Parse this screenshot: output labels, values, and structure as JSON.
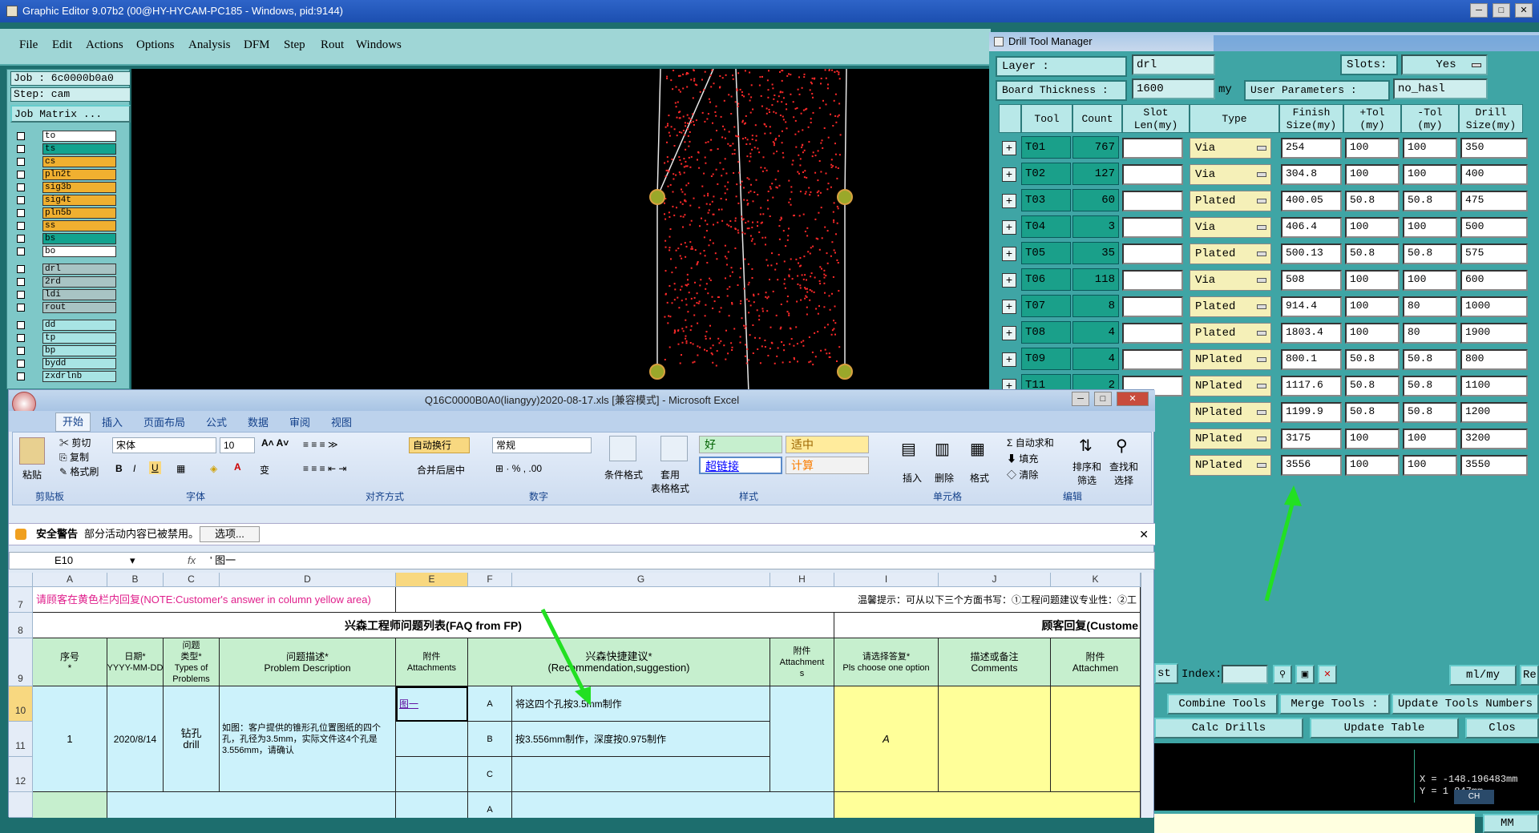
{
  "graphic_editor": {
    "title": "Graphic Editor 9.07b2 (00@HY-HYCAM-PC185 - Windows, pid:9144)",
    "menu": [
      "File",
      "Edit",
      "Actions",
      "Options",
      "Analysis",
      "DFM",
      "Step",
      "Rout",
      "Windows"
    ],
    "job": "Job : 6c0000b0a0",
    "step": "Step: cam",
    "job_matrix": "Job Matrix ...",
    "layers": [
      {
        "name": "to",
        "color": "#ffffff"
      },
      {
        "name": "ts",
        "color": "#13a38f"
      },
      {
        "name": "cs",
        "color": "#f0b030"
      },
      {
        "name": "pln2t",
        "color": "#f0b030"
      },
      {
        "name": "sig3b",
        "color": "#f0b030"
      },
      {
        "name": "sig4t",
        "color": "#f0b030"
      },
      {
        "name": "pln5b",
        "color": "#f0b030"
      },
      {
        "name": "ss",
        "color": "#f0b030"
      },
      {
        "name": "bs",
        "color": "#13a38f"
      },
      {
        "name": "bo",
        "color": "#ffffff"
      },
      {
        "name": "drl",
        "color": "#a8c4c4"
      },
      {
        "name": "2rd",
        "color": "#a8c4c4"
      },
      {
        "name": "ldi",
        "color": "#a8c4c4"
      },
      {
        "name": "rout",
        "color": "#a8c4c4"
      },
      {
        "name": "dd",
        "color": "#a8e4e4"
      },
      {
        "name": "tp",
        "color": "#a8e4e4"
      },
      {
        "name": "bp",
        "color": "#a8e4e4"
      },
      {
        "name": "bydd",
        "color": "#a8e4e4"
      },
      {
        "name": "zxdrlnb",
        "color": "#a8e4e4"
      }
    ]
  },
  "drill_tool_manager": {
    "title": "Drill Tool Manager",
    "layer_label": "Layer :",
    "layer_value": "drl",
    "slots_label": "Slots:",
    "slots_value": "Yes",
    "board_thickness_label": "Board Thickness :",
    "board_thickness_value": "1600",
    "board_thickness_unit": "my",
    "user_params_label": "User Parameters :",
    "user_params_value": "no_hasl",
    "headers": [
      "Tool",
      "Count",
      "Slot Len(my)",
      "Type",
      "Finish Size(my)",
      "+Tol (my)",
      "-Tol (my)",
      "Drill Size(my)"
    ],
    "rows": [
      {
        "tool": "T01",
        "count": "767",
        "type": "Via",
        "finish": "254",
        "ptol": "100",
        "ntol": "100",
        "drill": "350"
      },
      {
        "tool": "T02",
        "count": "127",
        "type": "Via",
        "finish": "304.8",
        "ptol": "100",
        "ntol": "100",
        "drill": "400"
      },
      {
        "tool": "T03",
        "count": "60",
        "type": "Plated",
        "finish": "400.05",
        "ptol": "50.8",
        "ntol": "50.8",
        "drill": "475"
      },
      {
        "tool": "T04",
        "count": "3",
        "type": "Via",
        "finish": "406.4",
        "ptol": "100",
        "ntol": "100",
        "drill": "500"
      },
      {
        "tool": "T05",
        "count": "35",
        "type": "Plated",
        "finish": "500.13",
        "ptol": "50.8",
        "ntol": "50.8",
        "drill": "575"
      },
      {
        "tool": "T06",
        "count": "118",
        "type": "Via",
        "finish": "508",
        "ptol": "100",
        "ntol": "100",
        "drill": "600"
      },
      {
        "tool": "T07",
        "count": "8",
        "type": "Plated",
        "finish": "914.4",
        "ptol": "100",
        "ntol": "80",
        "drill": "1000"
      },
      {
        "tool": "T08",
        "count": "4",
        "type": "Plated",
        "finish": "1803.4",
        "ptol": "100",
        "ntol": "80",
        "drill": "1900"
      },
      {
        "tool": "T09",
        "count": "4",
        "type": "NPlated",
        "finish": "800.1",
        "ptol": "50.8",
        "ntol": "50.8",
        "drill": "800"
      },
      {
        "tool": "T11",
        "count": "2",
        "type": "NPlated",
        "finish": "1117.6",
        "ptol": "50.8",
        "ntol": "50.8",
        "drill": "1100"
      },
      {
        "tool": "",
        "count": "",
        "type": "NPlated",
        "finish": "1199.9",
        "ptol": "50.8",
        "ntol": "50.8",
        "drill": "1200"
      },
      {
        "tool": "",
        "count": "",
        "type": "NPlated",
        "finish": "3175",
        "ptol": "100",
        "ntol": "100",
        "drill": "3200"
      },
      {
        "tool": "",
        "count": "",
        "type": "NPlated",
        "finish": "3556",
        "ptol": "100",
        "ntol": "100",
        "drill": "3550"
      }
    ],
    "index_label": "Index:",
    "unit_select": "ml/my",
    "re_label": "Re",
    "st_label": "st",
    "combine_tools": "Combine Tools",
    "merge_tools": "Merge Tools :",
    "update_tools_numbers": "Update Tools Numbers",
    "calc_drills": "Calc Drills",
    "update_table": "Update Table",
    "close": "Clos",
    "coord_x": "X = -148.196483mm",
    "coord_y": "Y = 1    847mm",
    "mm_select": "MM",
    "ch_label": "CH"
  },
  "excel": {
    "title": "Q16C0000B0A0(liangyy)2020-08-17.xls  [兼容模式] - Microsoft Excel",
    "tabs": [
      "开始",
      "插入",
      "页面布局",
      "公式",
      "数据",
      "审阅",
      "视图"
    ],
    "clipboard": {
      "paste": "粘贴",
      "cut": "剪切",
      "copy": "复制",
      "format_painter": "格式刷",
      "group": "剪贴板"
    },
    "font": {
      "name": "宋体",
      "size": "10",
      "group": "字体"
    },
    "alignment": {
      "wrap": "自动换行",
      "merge": "合并后居中",
      "group": "对齐方式"
    },
    "number": {
      "format": "常规",
      "group": "数字"
    },
    "styles": {
      "cond_format": "条件格式",
      "table_format": "套用\n表格格式",
      "good": "好",
      "neutral": "适中",
      "hyperlink": "超链接",
      "calc": "计算",
      "group": "样式"
    },
    "cells": {
      "insert": "插入",
      "delete": "删除",
      "format": "格式",
      "group": "单元格"
    },
    "editing": {
      "autosum": "自动求和",
      "fill": "填充",
      "clear": "清除",
      "sort": "排序和\n筛选",
      "find": "查找和\n选择",
      "group": "编辑"
    },
    "security_warning": "安全警告",
    "security_msg": "部分活动内容已被禁用。",
    "options_btn": "选项...",
    "name_box": "E10",
    "formula": "' 图一",
    "columns": [
      "A",
      "B",
      "C",
      "D",
      "E",
      "F",
      "G",
      "H",
      "I",
      "J",
      "K"
    ],
    "row_numbers": [
      "7",
      "8",
      "9",
      "10",
      "11",
      "12"
    ],
    "row7_note": "请顾客在黄色栏内回复(NOTE:Customer's answer in column yellow area)",
    "row7_tip": "温馨提示：可从以下三个方面书写：①工程问题建议专业性：②工",
    "row8_left": "兴森工程师问题列表(FAQ from FP)",
    "row8_right": "顾客回复(Custome",
    "headers": {
      "seq": "序号\n*",
      "date": "日期*\nYYYY-MM-DD",
      "type": "问题\n类型*\nTypes of\nProblems",
      "desc": "问题描述*\nProblem Description",
      "attach": "附件\nAttachments",
      "suggest": "兴森快捷建议*\n(Recommendation,suggestion)",
      "attach2": "附件\nAttachment\ns",
      "choose": "请选择答复*\nPls choose one option",
      "comments": "描述或备注\nComments",
      "attach3": "附件\nAttachmen"
    },
    "data_row": {
      "seq": "1",
      "date": "2020/8/14",
      "type": "钻孔\ndrill",
      "desc": "如图：客户提供的锥形孔位置图纸的四个孔，孔径为3.5mm，实际文件这4个孔是3.556mm，请确认",
      "attach": "图一",
      "opt_a": "A",
      "opt_b": "B",
      "opt_c": "C",
      "opt_a2": "A",
      "sug_a": "将这四个孔按3.5mm制作",
      "sug_b": "按3.556mm制作，深度按0.975制作",
      "answer": "A"
    }
  }
}
